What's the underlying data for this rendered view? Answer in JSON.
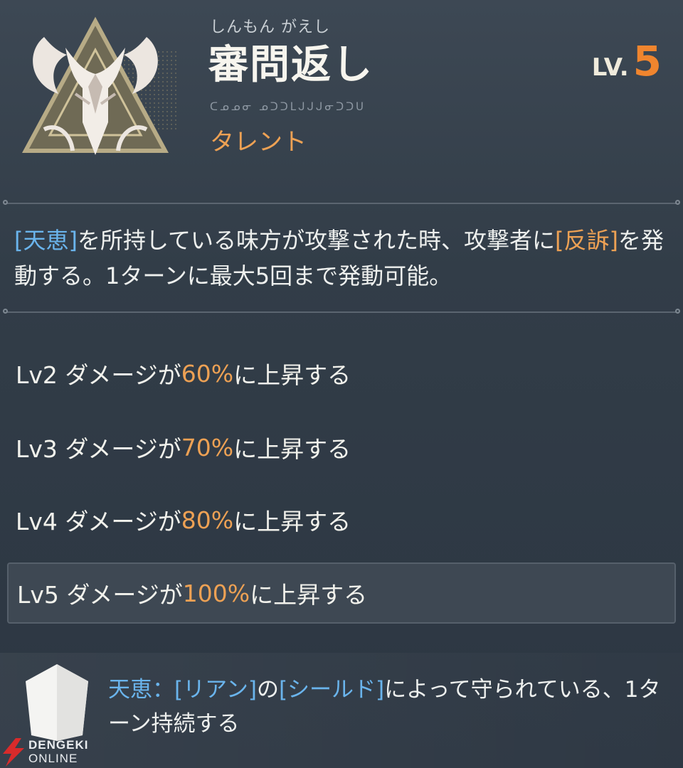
{
  "header": {
    "ruby": "しんもん がえし",
    "title": "審問返し",
    "level_prefix": "LV.",
    "level_value": "5",
    "script_text": "ᑕᓄᓄᓂ ᓄᑐᑐᒪᒍᒍᒍᓂᑐᑐᑌ",
    "type_label": "タレント",
    "emblem_icon": "talent-emblem-icon"
  },
  "description": {
    "tag1": "[天恵]",
    "text1": "を所持している味方が攻撃された時、攻撃者に",
    "tag2": "[反訴]",
    "text2": "を発動する。1ターンに最大5回まで発動可能。"
  },
  "levels": [
    {
      "prefix": "Lv2 ダメージが",
      "value": "60%",
      "suffix": "に上昇する"
    },
    {
      "prefix": "Lv3 ダメージが",
      "value": "70%",
      "suffix": "に上昇する"
    },
    {
      "prefix": "Lv4 ダメージが",
      "value": "80%",
      "suffix": "に上昇する"
    },
    {
      "prefix": "Lv5 ダメージが",
      "value": "100%",
      "suffix": "に上昇する"
    }
  ],
  "note": {
    "icon": "shield-icon",
    "term": "天恵：",
    "tag1": "[リアン]",
    "text1": "の",
    "tag2": "[シールド]",
    "text2": "によって守られている、1ターン持続する"
  },
  "watermark": {
    "line1": "DENGEKI",
    "line2": "ONLINE"
  },
  "colors": {
    "accent_orange": "#eda154",
    "level_orange": "#f0852e",
    "tag_blue": "#6ab4ec",
    "background": "#323d48"
  }
}
